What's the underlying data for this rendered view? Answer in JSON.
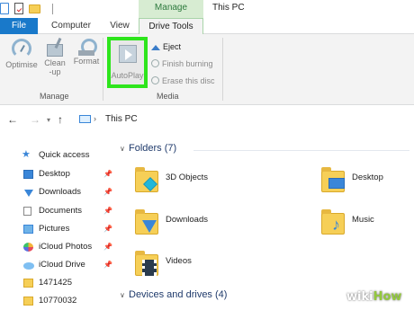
{
  "window": {
    "title": "This PC",
    "context_tab": "Manage"
  },
  "tabs": {
    "file": "File",
    "computer": "Computer",
    "view": "View",
    "drive_tools": "Drive Tools"
  },
  "ribbon": {
    "manage_group": {
      "label": "Manage",
      "optimise": "Optimise",
      "cleanup_line1": "Clean",
      "cleanup_line2": "-up",
      "format": "Format"
    },
    "media_group": {
      "label": "Media",
      "autoplay": "AutoPlay",
      "eject": "Eject",
      "finish_burning": "Finish burning",
      "erase_disc": "Erase this disc"
    },
    "highlight_color": "#2ee51c"
  },
  "address": {
    "path": "This PC"
  },
  "nav_pane": {
    "quick_access": "Quick access",
    "items": [
      {
        "label": "Desktop",
        "pinned": true
      },
      {
        "label": "Downloads",
        "pinned": true
      },
      {
        "label": "Documents",
        "pinned": true
      },
      {
        "label": "Pictures",
        "pinned": true
      },
      {
        "label": "iCloud Photos",
        "pinned": true
      },
      {
        "label": "iCloud Drive",
        "pinned": true
      },
      {
        "label": "1471425",
        "pinned": false
      },
      {
        "label": "10770032",
        "pinned": false
      }
    ]
  },
  "content": {
    "folders_header": "Folders (7)",
    "folders": [
      {
        "label": "3D Objects"
      },
      {
        "label": "Desktop"
      },
      {
        "label": "Downloads"
      },
      {
        "label": "Music"
      },
      {
        "label": "Videos"
      }
    ],
    "devices_header": "Devices and drives (4)"
  },
  "watermark": {
    "wiki": "wiki",
    "how": "How"
  }
}
